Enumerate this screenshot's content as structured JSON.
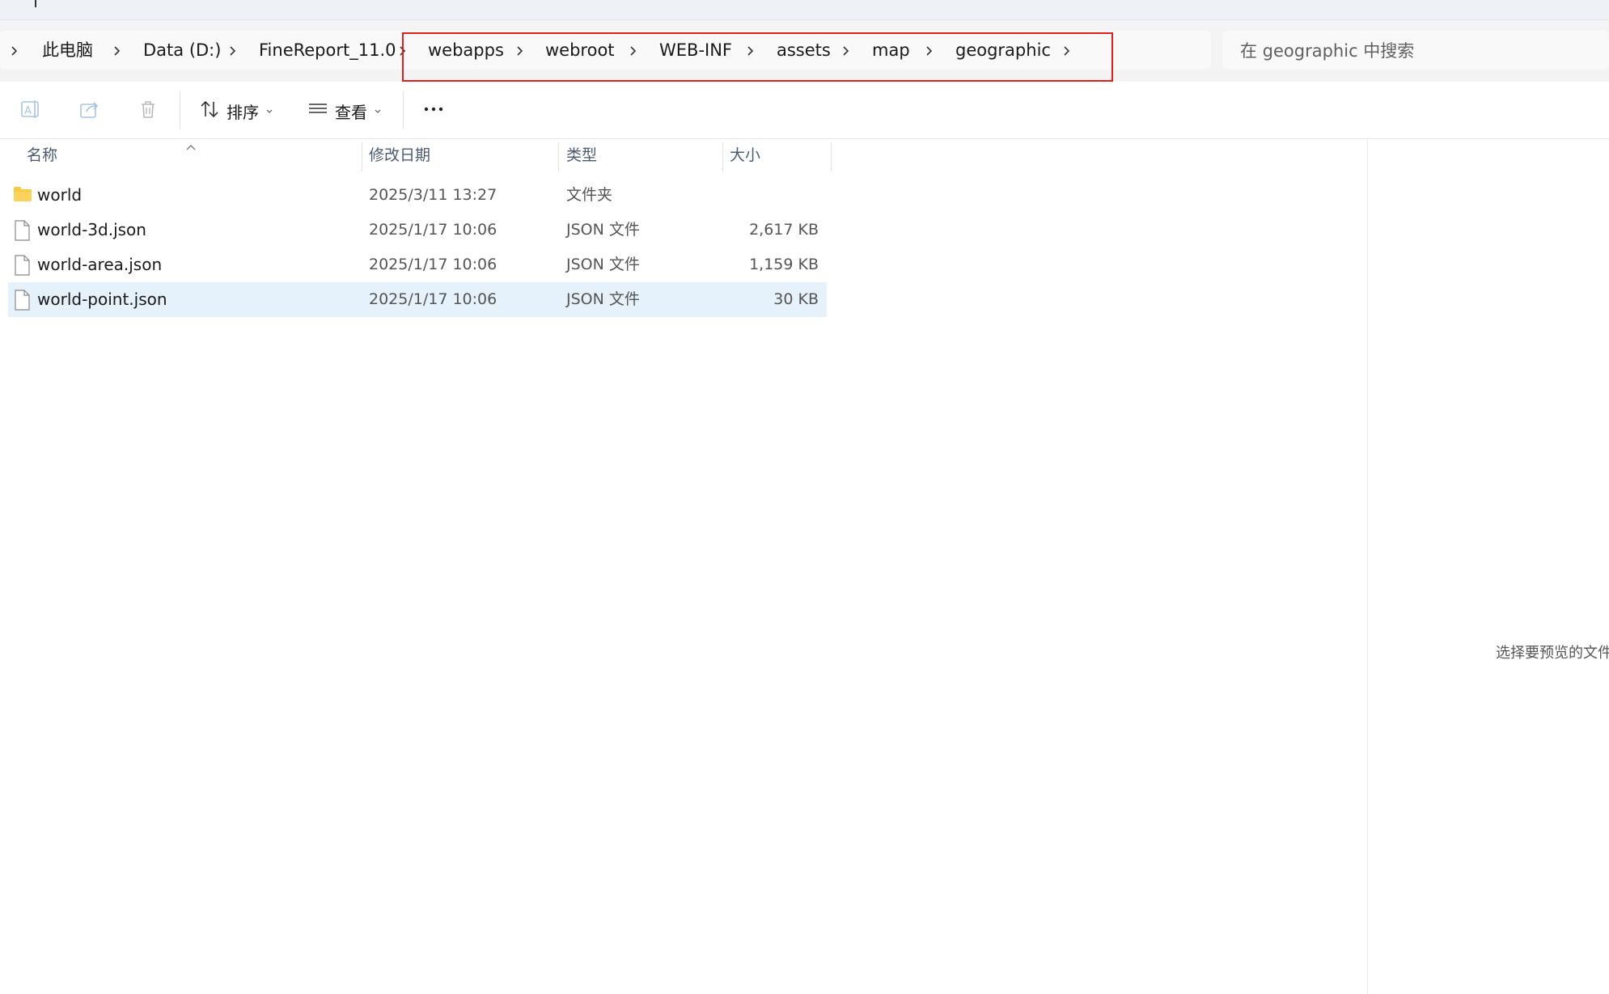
{
  "address": {
    "crumbs": [
      "此电脑",
      "Data (D:)",
      "FineReport_11.0",
      "webapps",
      "webroot",
      "WEB-INF",
      "assets",
      "map",
      "geographic"
    ]
  },
  "search": {
    "placeholder": "在 geographic 中搜索"
  },
  "toolbar": {
    "rename_icon": "rename-icon",
    "share_icon": "share-icon",
    "delete_icon": "trash-icon",
    "sort_label": "排序",
    "view_label": "查看",
    "more_icon": "more-icon"
  },
  "columns": {
    "name": "名称",
    "date": "修改日期",
    "type": "类型",
    "size": "大小"
  },
  "files": [
    {
      "name": "world",
      "date": "2025/3/11 13:27",
      "type": "文件夹",
      "size": "",
      "icon": "folder-icon"
    },
    {
      "name": "world-3d.json",
      "date": "2025/1/17 10:06",
      "type": "JSON 文件",
      "size": "2,617 KB",
      "icon": "file-icon"
    },
    {
      "name": "world-area.json",
      "date": "2025/1/17 10:06",
      "type": "JSON 文件",
      "size": "1,159 KB",
      "icon": "file-icon"
    },
    {
      "name": "world-point.json",
      "date": "2025/1/17 10:06",
      "type": "JSON 文件",
      "size": "30 KB",
      "icon": "file-icon",
      "selected": true
    }
  ],
  "preview": {
    "empty_text": "选择要预览的文件"
  },
  "colors": {
    "highlight_box": "#e0201f",
    "selection": "#e5f1fb",
    "folder": "#f8c945"
  }
}
